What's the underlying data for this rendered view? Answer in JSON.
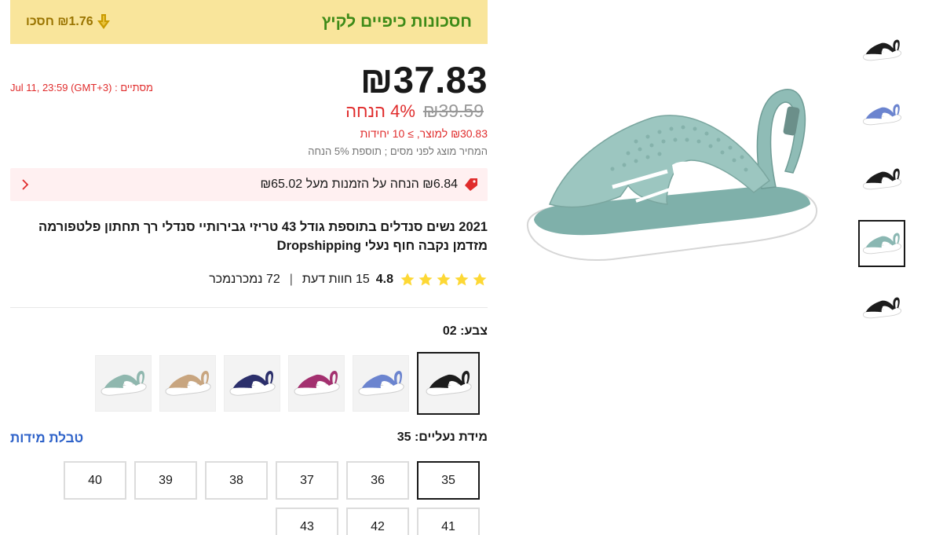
{
  "banner": {
    "title": "חסכונות כיפיים לקיץ",
    "save_text": "₪1.76 חסכו"
  },
  "price": {
    "current": "₪37.83",
    "original": "₪39.59",
    "discount": "4% הנחה",
    "bulk": "₪30.83 למוצר, ≥ 10 יחידות",
    "tax_note": "המחיר מוצג לפני מסים ; תוספת 5% הנחה"
  },
  "timer": {
    "label": "מסתיים :",
    "value": "Jul 11, 23:59 (GMT+3)"
  },
  "coupon": {
    "text": "₪6.84 הנחה על הזמנות מעל ₪65.02"
  },
  "product": {
    "title": "2021 נשים סנדלים בתוספת גודל 43 טריזי גבירותיי סנדלי רך תחתון פלטפורמה מזדמן נקבה חוף נעלי Dropshipping"
  },
  "rating": {
    "score": "4.8",
    "reviews": "15 חוות דעת",
    "sold": "72 נמכרנמכר"
  },
  "color": {
    "label": "צבע: 02",
    "swatches": [
      {
        "name": "black",
        "color": "#1c1c1c",
        "selected": true
      },
      {
        "name": "blue",
        "color": "#6b84cf",
        "selected": false
      },
      {
        "name": "magenta",
        "color": "#a3306f",
        "selected": false
      },
      {
        "name": "navy",
        "color": "#2b2f6b",
        "selected": false
      },
      {
        "name": "khaki",
        "color": "#c8a57f",
        "selected": false
      },
      {
        "name": "mint",
        "color": "#8fb7ae",
        "selected": false
      }
    ]
  },
  "size": {
    "label": "מידת נעליים: 35",
    "chart_link": "טבלת מידות",
    "options": [
      "35",
      "36",
      "37",
      "38",
      "39",
      "40",
      "41",
      "42",
      "43"
    ],
    "selected": "35"
  },
  "gallery": {
    "main_color": "#8ab7b2",
    "thumbs": [
      {
        "color": "#1c1c1c"
      },
      {
        "color": "#6b84cf"
      },
      {
        "color": "#1c1c1c"
      },
      {
        "color": "#8ab7b2",
        "selected": true
      },
      {
        "color": "#1c1c1c"
      }
    ]
  },
  "colors": {
    "accent_red": "#e02c2c",
    "banner_bg": "#f9e59b",
    "banner_green": "#3d8a17",
    "link_blue": "#2e62c9",
    "star_yellow": "#fdd835"
  }
}
